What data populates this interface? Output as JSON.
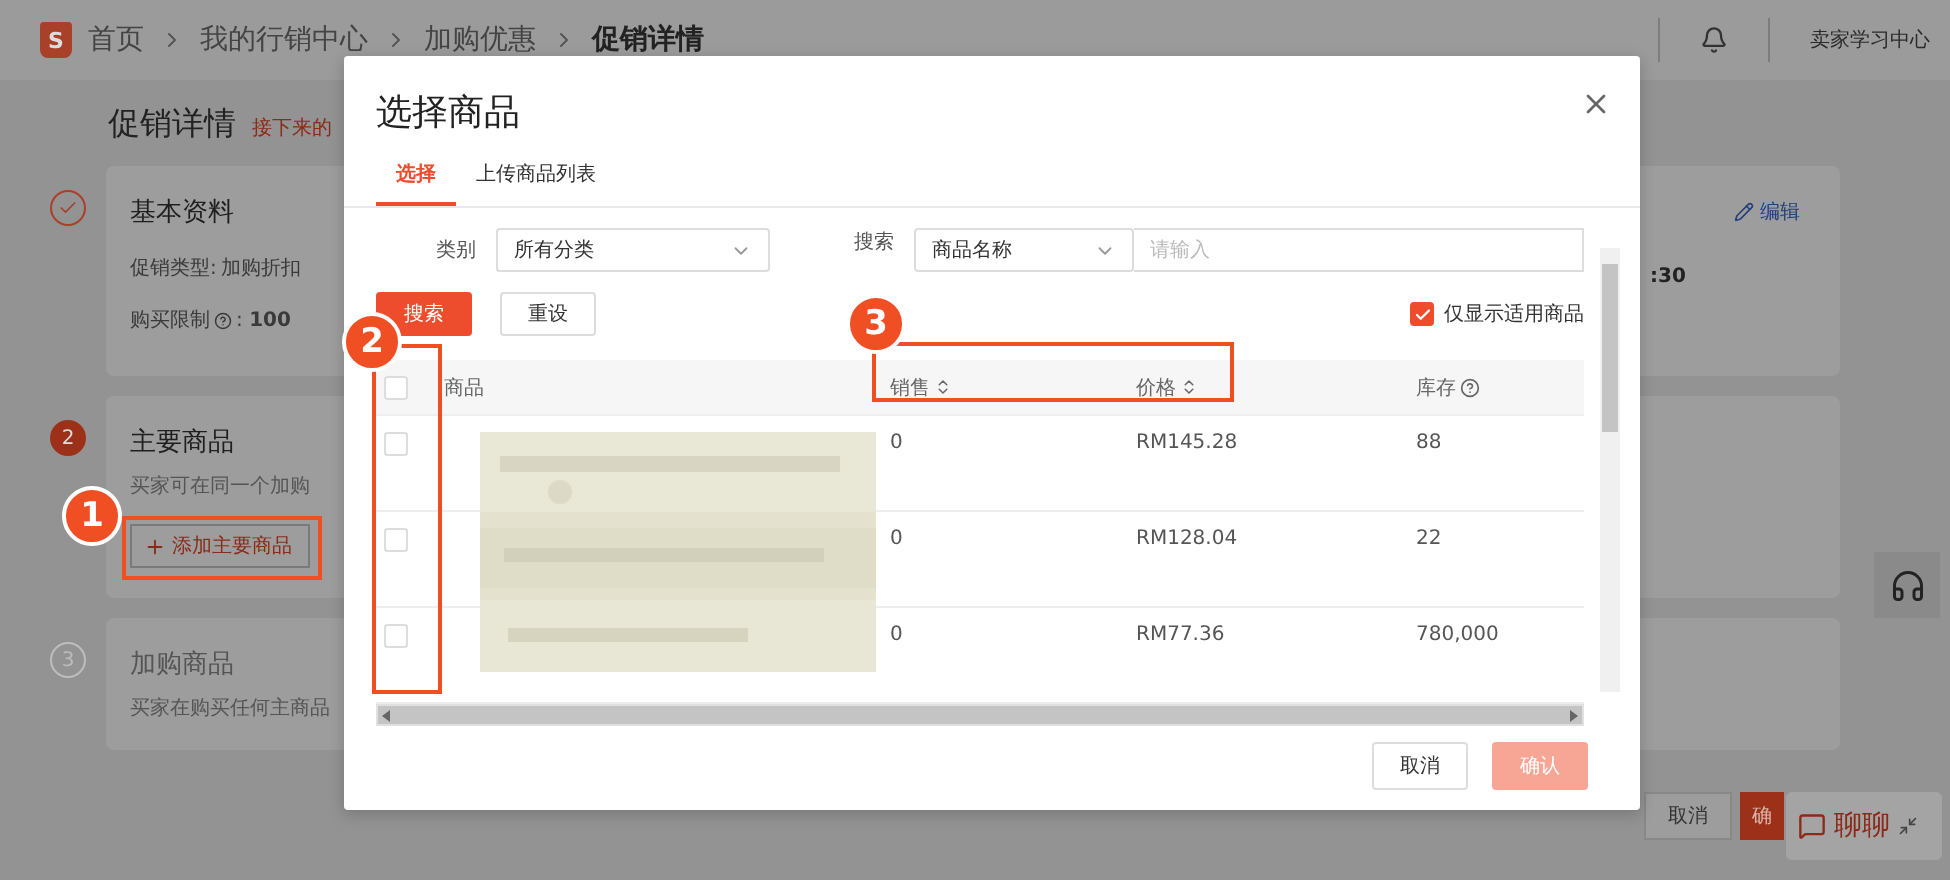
{
  "top_bar": {
    "logo": "S",
    "breadcrumb": [
      "首页",
      "我的行销中心",
      "加购优惠",
      "促销详情"
    ],
    "help_link": "卖家学习中心"
  },
  "page": {
    "title": "促销详情",
    "note": "接下来的"
  },
  "steps": [
    {
      "kind": "done",
      "title": "基本资料",
      "fields": [
        {
          "kind": "plain",
          "label": "促销类型:",
          "value": "加购折扣"
        },
        {
          "kind": "help",
          "label": "购买限制",
          "value": ": **100**"
        }
      ],
      "edit": "编辑",
      "trailing": ":30"
    },
    {
      "kind": "active",
      "number": "2",
      "title": "主要商品",
      "description": "买家可在同一个加购",
      "action": "添加主要商品"
    },
    {
      "kind": "pending",
      "number": "3",
      "title": "加购商品",
      "description": "买家在购买任何主商品"
    }
  ],
  "page_footer": [
    {
      "label": "取消",
      "kind": "secondary"
    },
    {
      "label": "确",
      "kind": "primary"
    }
  ],
  "chat": {
    "label": "聊聊"
  },
  "modal": {
    "title": "选择商品",
    "tabs": [
      {
        "label": "选择",
        "selected": true
      },
      {
        "label": "上传商品列表",
        "selected": false
      }
    ],
    "category": {
      "label": "类别",
      "value": "所有分类"
    },
    "search": {
      "label": "搜索",
      "field": "商品名称",
      "placeholder": "请输入"
    },
    "buttons": [
      {
        "label": "搜索",
        "kind": "primary"
      },
      {
        "label": "重设",
        "kind": "secondary"
      }
    ],
    "filter": {
      "label": "仅显示适用商品",
      "checked": true
    },
    "table": {
      "all_checked": false,
      "columns": [
        {
          "kind": "plain",
          "label": "商品"
        },
        {
          "kind": "sortable",
          "label": "销售"
        },
        {
          "kind": "sortable",
          "label": "价格"
        },
        {
          "kind": "help",
          "label": "库存"
        }
      ],
      "rows": [
        {
          "checked": false,
          "sales": "0",
          "price": "RM145.28",
          "stock": "88"
        },
        {
          "checked": false,
          "sales": "0",
          "price": "RM128.04",
          "stock": "22"
        },
        {
          "checked": false,
          "sales": "0",
          "price": "RM77.36",
          "stock": "780,000"
        }
      ]
    },
    "footer": [
      {
        "label": "取消",
        "kind": "secondary",
        "disabled": false
      },
      {
        "label": "确认",
        "kind": "primary",
        "disabled": true
      }
    ]
  },
  "annotations": [
    {
      "number": "1"
    },
    {
      "number": "2"
    },
    {
      "number": "3"
    }
  ]
}
